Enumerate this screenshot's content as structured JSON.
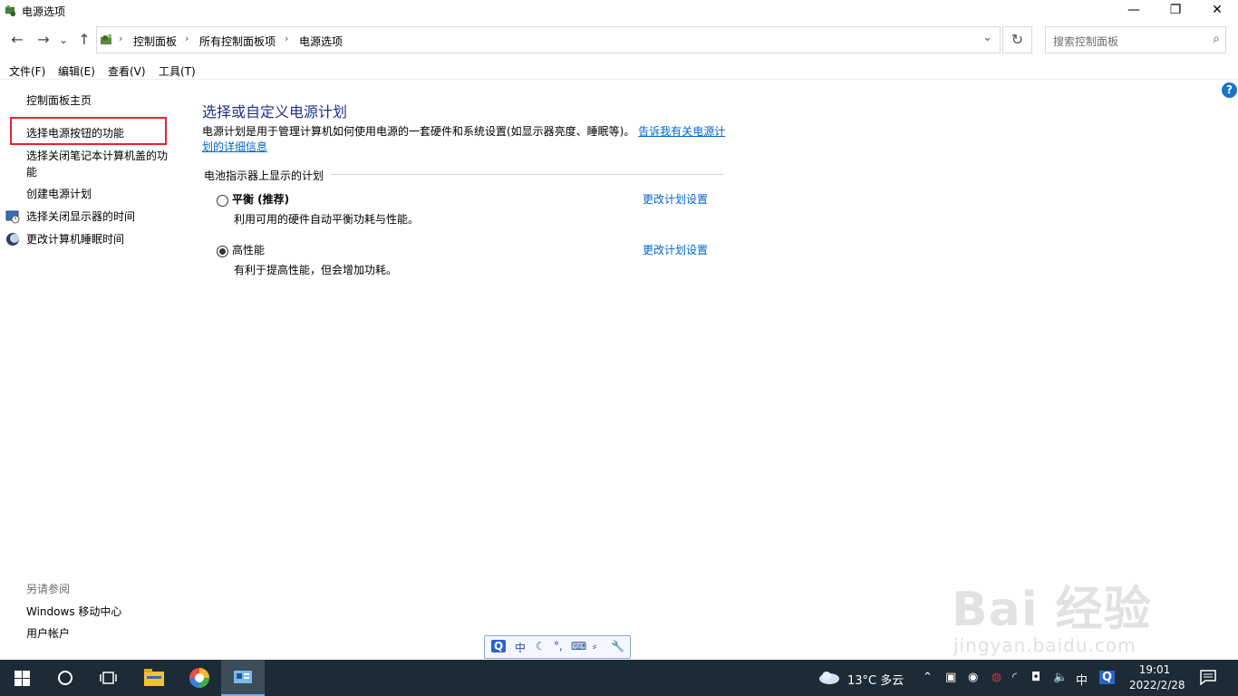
{
  "window": {
    "title": "电源选项",
    "minimize_glyph": "—",
    "maximize_glyph": "❐",
    "close_glyph": "✕"
  },
  "nav": {
    "back_glyph": "←",
    "forward_glyph": "→",
    "recent_glyph": "⌄",
    "up_glyph": "↑",
    "breadcrumb": [
      "控制面板",
      "所有控制面板项",
      "电源选项"
    ],
    "breadcrumb_sep": "›",
    "dropdown_glyph": "⌄",
    "refresh_glyph": "↻",
    "search_placeholder": "搜索控制面板",
    "search_glyph": "⌕"
  },
  "menu": [
    "文件(F)",
    "编辑(E)",
    "查看(V)",
    "工具(T)"
  ],
  "sidebar": {
    "items": [
      {
        "label": "控制面板主页"
      },
      {
        "label": "选择电源按钮的功能"
      },
      {
        "label": "选择关闭笔记本计算机盖的功能"
      },
      {
        "label": "创建电源计划"
      },
      {
        "label": "选择关闭显示器的时间"
      },
      {
        "label": "更改计算机睡眠时间"
      }
    ],
    "see_also_title": "另请参阅",
    "see_also": [
      "Windows 移动中心",
      "用户帐户"
    ]
  },
  "main": {
    "title": "选择或自定义电源计划",
    "description": "电源计划是用于管理计算机如何使用电源的一套硬件和系统设置(如显示器亮度、睡眠等)。",
    "description_link": "告诉我有关电源计划的详细信息",
    "group_label": "电池指示器上显示的计划",
    "plans": [
      {
        "name": "平衡 (推荐)",
        "desc": "利用可用的硬件自动平衡功耗与性能。",
        "link": "更改计划设置",
        "selected": false
      },
      {
        "name": "高性能",
        "desc": "有利于提高性能，但会增加功耗。",
        "link": "更改计划设置",
        "selected": true
      }
    ],
    "help_glyph": "?"
  },
  "ime": {
    "items": [
      "Q",
      "中",
      "☾",
      "°,",
      "⌨",
      "⸗",
      "🔧"
    ]
  },
  "watermark": {
    "line1": "Bai 经验",
    "line2": "jingyan.baidu.com"
  },
  "taskbar": {
    "weather": "13°C 多云",
    "ime_lang": "中",
    "time": "19:01",
    "date": "2022/2/28"
  },
  "colors": {
    "accent_link": "#0066cc",
    "title_blue": "#1e3287",
    "highlight_box": "#e5252a",
    "taskbar": "#1c2b36"
  }
}
